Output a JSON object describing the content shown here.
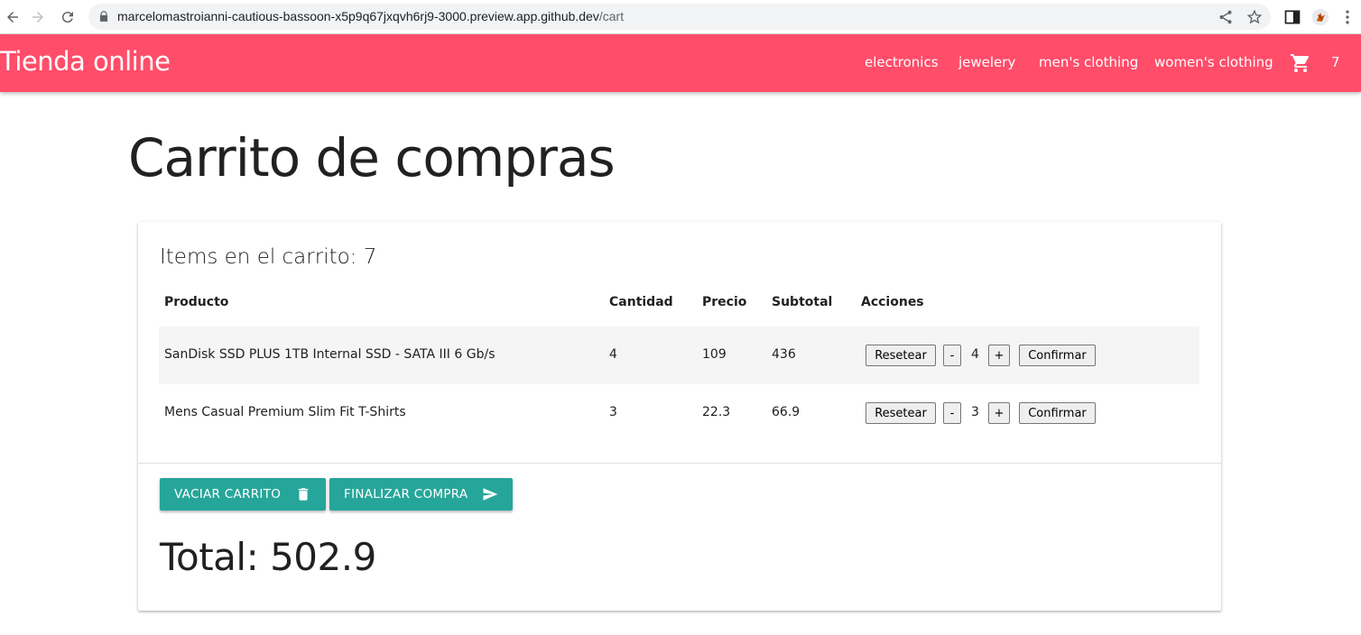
{
  "browser": {
    "url_host": "marcelomastroianni-cautious-bassoon-x5p9q67jxqvh6rj9-3000.preview.app.github.dev",
    "url_path": "/cart",
    "icons": [
      "back-icon",
      "forward-icon",
      "reload-icon",
      "lock-icon",
      "share-icon",
      "star-icon",
      "sidepanel-icon",
      "extension-icon",
      "menu-icon"
    ]
  },
  "appbar": {
    "brand": "Tienda online",
    "links": [
      "electronics",
      "jewelery",
      "men's clothing",
      "women's clothing"
    ],
    "cart_count": "7",
    "color": "#ff4d6a"
  },
  "page": {
    "title": "Carrito de compras"
  },
  "cart": {
    "items_label": "Items en el carrito: 7",
    "headers": [
      "Producto",
      "Cantidad",
      "Precio",
      "Subtotal",
      "Acciones"
    ],
    "rows": [
      {
        "product": "SanDisk SSD PLUS 1TB Internal SSD - SATA III 6 Gb/s",
        "quantity": "4",
        "price": "109",
        "subtotal": "436",
        "counter": "4"
      },
      {
        "product": "Mens Casual Premium Slim Fit T-Shirts",
        "quantity": "3",
        "price": "22.3",
        "subtotal": "66.9",
        "counter": "3"
      }
    ],
    "row_actions": {
      "reset": "Resetear",
      "minus": "-",
      "plus": "+",
      "confirm": "Confirmar"
    },
    "empty_button": "VACIAR CARRITO",
    "checkout_button": "FINALIZAR COMPRA",
    "total": "Total: 502.9",
    "accent": "#26a69a"
  }
}
